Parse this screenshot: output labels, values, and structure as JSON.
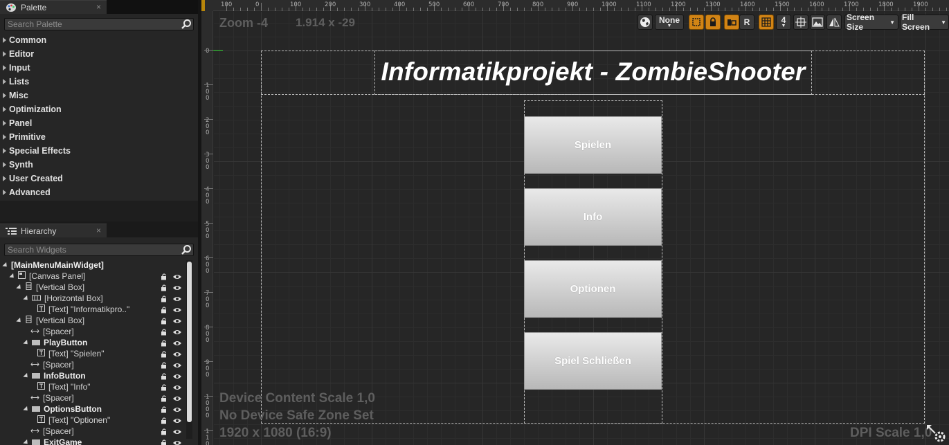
{
  "palette": {
    "tab_label": "Palette",
    "close": "×",
    "search_placeholder": "Search Palette",
    "categories": [
      "Common",
      "Editor",
      "Input",
      "Lists",
      "Misc",
      "Optimization",
      "Panel",
      "Primitive",
      "Special Effects",
      "Synth",
      "User Created",
      "Advanced"
    ]
  },
  "hierarchy": {
    "tab_label": "Hierarchy",
    "close": "×",
    "search_placeholder": "Search Widgets",
    "rows": [
      {
        "label": "[MainMenuMainWidget]",
        "indent": 0,
        "bold": true,
        "toggle": "open",
        "icon": "none"
      },
      {
        "label": "[Canvas Panel]",
        "indent": 1,
        "bold": false,
        "toggle": "open",
        "icon": "canvas-icon"
      },
      {
        "label": "[Vertical Box]",
        "indent": 2,
        "bold": false,
        "toggle": "open",
        "icon": "vbox-icon"
      },
      {
        "label": "[Horizontal Box]",
        "indent": 3,
        "bold": false,
        "toggle": "open",
        "icon": "hbox-icon"
      },
      {
        "label": "[Text] \"Informatikpro..\"",
        "indent": 4,
        "bold": false,
        "toggle": "none",
        "icon": "text-icon"
      },
      {
        "label": "[Vertical Box]",
        "indent": 2,
        "bold": false,
        "toggle": "open",
        "icon": "vbox-icon"
      },
      {
        "label": "[Spacer]",
        "indent": 3,
        "bold": false,
        "toggle": "none",
        "icon": "spacer-icon"
      },
      {
        "label": "PlayButton",
        "indent": 3,
        "bold": true,
        "toggle": "open",
        "icon": "button-icon"
      },
      {
        "label": "[Text] \"Spielen\"",
        "indent": 4,
        "bold": false,
        "toggle": "none",
        "icon": "text-icon"
      },
      {
        "label": "[Spacer]",
        "indent": 3,
        "bold": false,
        "toggle": "none",
        "icon": "spacer-icon"
      },
      {
        "label": "InfoButton",
        "indent": 3,
        "bold": true,
        "toggle": "open",
        "icon": "button-icon"
      },
      {
        "label": "[Text] \"Info\"",
        "indent": 4,
        "bold": false,
        "toggle": "none",
        "icon": "text-icon"
      },
      {
        "label": "[Spacer]",
        "indent": 3,
        "bold": false,
        "toggle": "none",
        "icon": "spacer-icon"
      },
      {
        "label": "OptionsButton",
        "indent": 3,
        "bold": true,
        "toggle": "open",
        "icon": "button-icon"
      },
      {
        "label": "[Text] \"Optionen\"",
        "indent": 4,
        "bold": false,
        "toggle": "none",
        "icon": "text-icon"
      },
      {
        "label": "[Spacer]",
        "indent": 3,
        "bold": false,
        "toggle": "none",
        "icon": "spacer-icon"
      },
      {
        "label": "ExitGame",
        "indent": 3,
        "bold": true,
        "toggle": "open",
        "icon": "button-icon"
      }
    ]
  },
  "designer": {
    "zoom": "Zoom -4",
    "coords": "1.914 x -29",
    "device_content_scale": "Device Content Scale 1,0",
    "safe_zone": "No Device Safe Zone Set",
    "resolution": "1920 x 1080 (16:9)",
    "dpi_scale": "DPI Scale 1,0",
    "ruler_top": [
      "100",
      "0",
      "100",
      "200",
      "300",
      "400",
      "500",
      "600",
      "700",
      "800",
      "900",
      "1000",
      "1100",
      "1200",
      "1300",
      "1400",
      "1500",
      "1600",
      "1700",
      "1800",
      "1900"
    ],
    "ruler_left": [
      "0",
      "100",
      "200",
      "300",
      "400",
      "500",
      "600",
      "700",
      "800",
      "900",
      "1000",
      "1100"
    ],
    "toolbar": {
      "localization": "None",
      "respect_locks": "R",
      "grid_snap": "4",
      "screen_size": "Screen Size",
      "fill_screen": "Fill Screen"
    }
  },
  "widget": {
    "title": "Informatikprojekt - ZombieShooter",
    "buttons": [
      "Spielen",
      "Info",
      "Optionen",
      "Spiel Schließen"
    ]
  },
  "colors": {
    "accent_orange": "#d28415",
    "panel_bg": "#262626",
    "ruler_bg": "#2c2c2c",
    "button_top": "#e9e9e9",
    "button_bottom": "#b8b8b8"
  }
}
